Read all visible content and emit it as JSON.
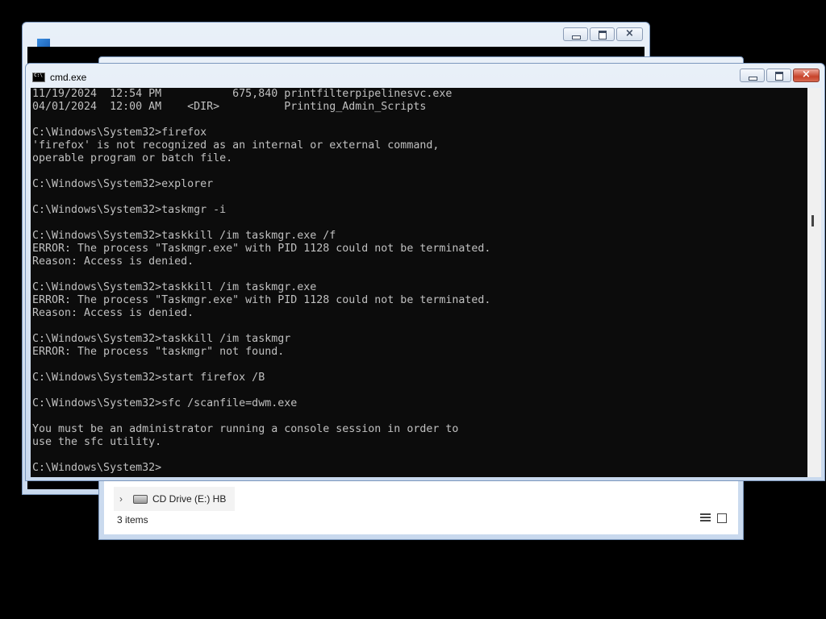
{
  "back_window": {
    "title": ""
  },
  "explorer_window": {
    "nav_item_label": "CD Drive (E:) HB",
    "status_text": "3 items"
  },
  "cmd_window": {
    "title": "cmd.exe",
    "console_lines": [
      "11/19/2024  12:54 PM           675,840 printfilterpipelinesvc.exe",
      "04/01/2024  12:00 AM    <DIR>          Printing_Admin_Scripts",
      "",
      "C:\\Windows\\System32>firefox",
      "'firefox' is not recognized as an internal or external command,",
      "operable program or batch file.",
      "",
      "C:\\Windows\\System32>explorer",
      "",
      "C:\\Windows\\System32>taskmgr -i",
      "",
      "C:\\Windows\\System32>taskkill /im taskmgr.exe /f",
      "ERROR: The process \"Taskmgr.exe\" with PID 1128 could not be terminated.",
      "Reason: Access is denied.",
      "",
      "C:\\Windows\\System32>taskkill /im taskmgr.exe",
      "ERROR: The process \"Taskmgr.exe\" with PID 1128 could not be terminated.",
      "Reason: Access is denied.",
      "",
      "C:\\Windows\\System32>taskkill /im taskmgr",
      "ERROR: The process \"taskmgr\" not found.",
      "",
      "C:\\Windows\\System32>start firefox /B",
      "",
      "C:\\Windows\\System32>sfc /scanfile=dwm.exe",
      "",
      "You must be an administrator running a console session in order to",
      "use the sfc utility.",
      "",
      "C:\\Windows\\System32>"
    ]
  },
  "icons": {
    "cmd": "cmd-icon",
    "minimize": "minimize-icon",
    "maximize": "maximize-icon",
    "close": "close-icon",
    "drive": "cd-drive-icon",
    "chevron": "chevron-right-icon"
  },
  "colors": {
    "console_bg": "#0c0c0c",
    "console_fg": "#c0c0c0",
    "close_button": "#c8432b"
  }
}
